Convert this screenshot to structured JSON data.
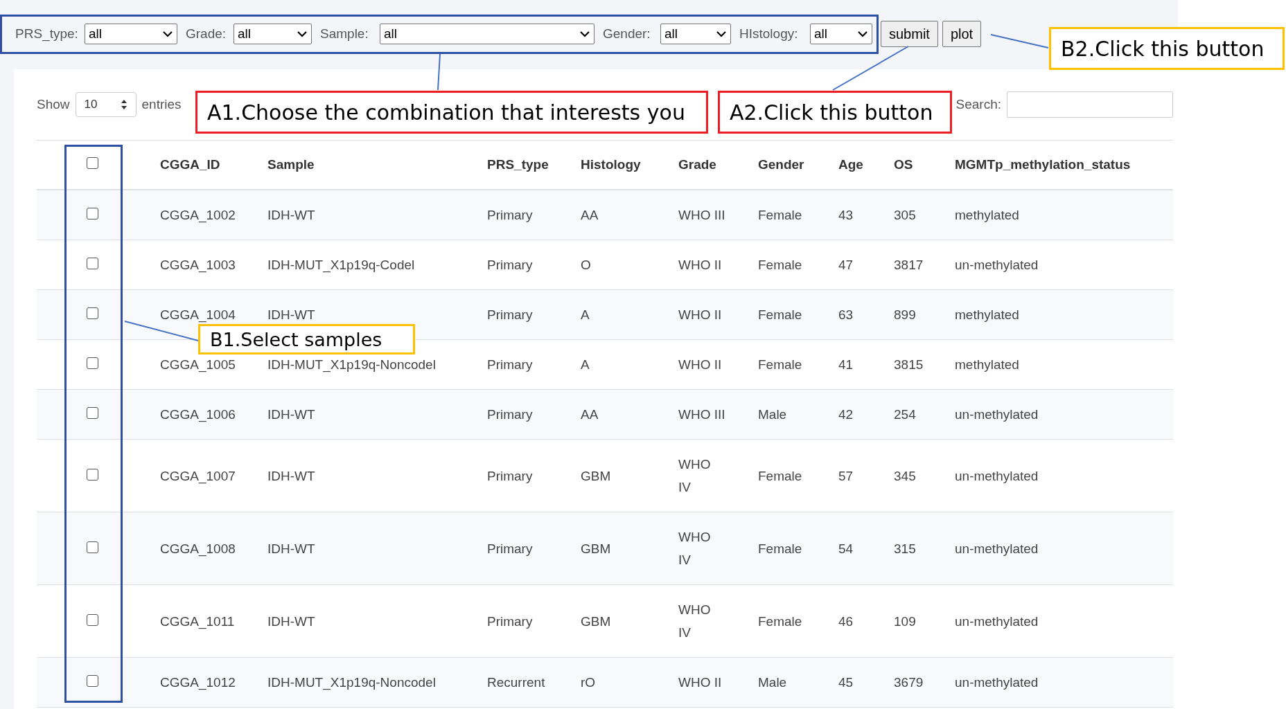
{
  "filters": [
    {
      "label": "PRS_type:",
      "value": "all"
    },
    {
      "label": "Grade:",
      "value": "all"
    },
    {
      "label": "Sample:",
      "value": "all"
    },
    {
      "label": "Gender:",
      "value": "all"
    },
    {
      "label": "HIstology:",
      "value": "all"
    }
  ],
  "buttons": [
    "submit",
    "plot"
  ],
  "length_control": {
    "show": "Show",
    "value": "10",
    "entries": "entries"
  },
  "search": {
    "label": "Search:"
  },
  "table": {
    "header_checkbox": {
      "checked": false
    },
    "columns": [
      "CGGA_ID",
      "Sample",
      "PRS_type",
      "Histology",
      "Grade",
      "Gender",
      "Age",
      "OS",
      "MGMTp_methylation_status"
    ],
    "rows": [
      {
        "checked": false,
        "cells": [
          "CGGA_1002",
          "IDH-WT",
          "Primary",
          "AA",
          "WHO III",
          "Female",
          "43",
          "305",
          "methylated"
        ]
      },
      {
        "checked": false,
        "cells": [
          "CGGA_1003",
          "IDH-MUT_X1p19q-Codel",
          "Primary",
          "O",
          "WHO II",
          "Female",
          "47",
          "3817",
          "un-methylated"
        ]
      },
      {
        "checked": false,
        "cells": [
          "CGGA_1004",
          "IDH-WT",
          "Primary",
          "A",
          "WHO II",
          "Female",
          "63",
          "899",
          "methylated"
        ]
      },
      {
        "checked": false,
        "cells": [
          "CGGA_1005",
          "IDH-MUT_X1p19q-Noncodel",
          "Primary",
          "A",
          "WHO II",
          "Female",
          "41",
          "3815",
          "methylated"
        ]
      },
      {
        "checked": false,
        "cells": [
          "CGGA_1006",
          "IDH-WT",
          "Primary",
          "AA",
          "WHO III",
          "Male",
          "42",
          "254",
          "un-methylated"
        ]
      },
      {
        "checked": false,
        "cells": [
          "CGGA_1007",
          "IDH-WT",
          "Primary",
          "GBM",
          "WHO IV",
          "Female",
          "57",
          "345",
          "un-methylated"
        ]
      },
      {
        "checked": false,
        "cells": [
          "CGGA_1008",
          "IDH-WT",
          "Primary",
          "GBM",
          "WHO IV",
          "Female",
          "54",
          "315",
          "un-methylated"
        ]
      },
      {
        "checked": false,
        "cells": [
          "CGGA_1011",
          "IDH-WT",
          "Primary",
          "GBM",
          "WHO IV",
          "Female",
          "46",
          "109",
          "un-methylated"
        ]
      },
      {
        "checked": false,
        "cells": [
          "CGGA_1012",
          "IDH-MUT_X1p19q-Noncodel",
          "Recurrent",
          "rO",
          "WHO II",
          "Male",
          "45",
          "3679",
          "un-methylated"
        ]
      }
    ]
  },
  "annotations": [
    {
      "text": "A1.Choose the combination that interests you",
      "color": "#ee1c25"
    },
    {
      "text": "A2.Click this button",
      "color": "#ee1c25"
    },
    {
      "text": "B2.Click this button",
      "color": "#ffc000"
    },
    {
      "text": "B1.Select samples",
      "color": "#ffc000"
    }
  ]
}
